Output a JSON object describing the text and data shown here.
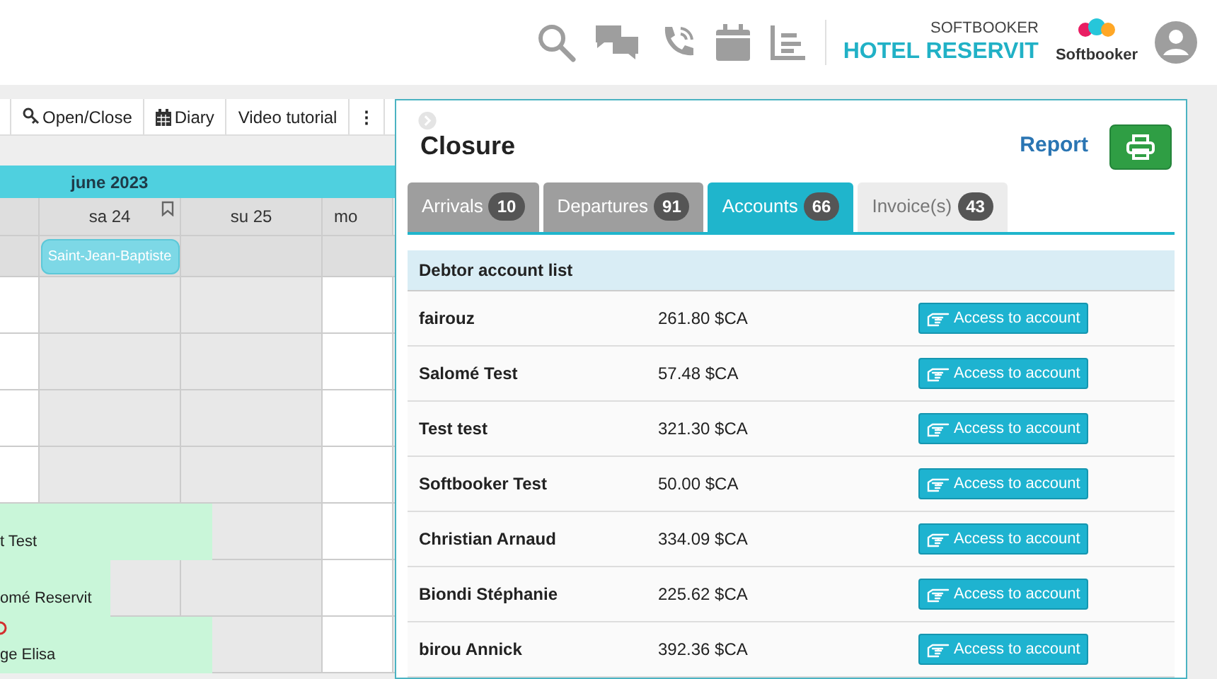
{
  "header": {
    "company": "SOFTBOOKER",
    "hotel": "HOTEL RESERVIT",
    "logo_text": "Softbooker"
  },
  "calendar": {
    "toolbar": [
      {
        "label": "Open/Close"
      },
      {
        "label": "Diary"
      },
      {
        "label": "Video tutorial"
      },
      {
        "label": "⋮"
      }
    ],
    "month": "june 2023",
    "days": [
      {
        "label": "sa 24",
        "bookmark": true
      },
      {
        "label": "su 25",
        "bookmark": false
      },
      {
        "label": "mo",
        "bookmark": false
      }
    ],
    "holiday": "Saint-Jean-Baptiste",
    "bookings": [
      {
        "label": "t Test",
        "alert": false
      },
      {
        "label": "omé Reservit",
        "alert": false
      },
      {
        "label": "ge Elisa",
        "alert": true
      }
    ]
  },
  "panel": {
    "title": "Closure",
    "report": "Report",
    "tabs": [
      {
        "label": "Arrivals",
        "count": "10",
        "selected": false
      },
      {
        "label": "Departures",
        "count": "91",
        "selected": false
      },
      {
        "label": "Accounts",
        "count": "66",
        "selected": true
      },
      {
        "label": "Invoice(s)",
        "count": "43",
        "selected": false
      }
    ],
    "list_title": "Debtor account list",
    "rows": [
      {
        "name": "fairouz",
        "amount": "261.80 $CA",
        "action": "Access to account"
      },
      {
        "name": "Salomé Test",
        "amount": "57.48 $CA",
        "action": "Access to account"
      },
      {
        "name": "Test test",
        "amount": "321.30 $CA",
        "action": "Access to account"
      },
      {
        "name": "Softbooker Test",
        "amount": "50.00 $CA",
        "action": "Access to account"
      },
      {
        "name": "Christian Arnaud",
        "amount": "334.09 $CA",
        "action": "Access to account"
      },
      {
        "name": "Biondi Stéphanie",
        "amount": "225.62 $CA",
        "action": "Access to account"
      },
      {
        "name": "birou Annick",
        "amount": "392.36 $CA",
        "action": "Access to account"
      }
    ]
  }
}
